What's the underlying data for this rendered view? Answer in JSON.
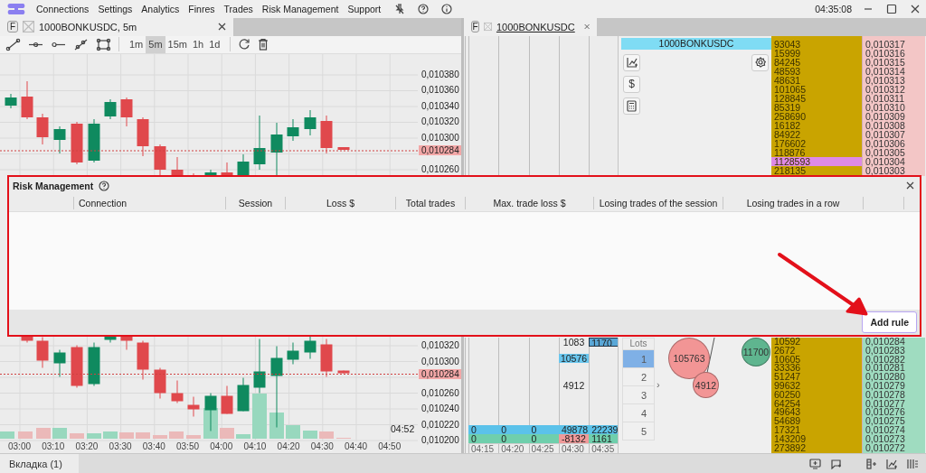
{
  "menu_bar": {
    "items": [
      {
        "label": "Connections"
      },
      {
        "label": "Settings"
      },
      {
        "label": "Analytics"
      },
      {
        "label": "Finres"
      },
      {
        "label": "Trades"
      },
      {
        "label": "Risk Management"
      },
      {
        "label": "Support"
      }
    ],
    "clock": "04:35:08"
  },
  "chart_panel": {
    "tab": {
      "badge": "F",
      "label": "1000BONKUSDC, 5m"
    },
    "timeframes": [
      {
        "label": "1m",
        "selected": false
      },
      {
        "label": "5m",
        "selected": true
      },
      {
        "label": "15m",
        "selected": false
      },
      {
        "label": "1h",
        "selected": false
      },
      {
        "label": "1d",
        "selected": false
      }
    ],
    "upper_axis": {
      "labels": [
        "0,010380",
        "0,010360",
        "0,010340",
        "0,010320",
        "0,010300",
        "0,010260"
      ],
      "last_price": "0,010284"
    },
    "lower_axis": {
      "labels": [
        "0,010320",
        "0,010300",
        "0,010260",
        "0,010240",
        "0,010220",
        "0,010200"
      ],
      "last_price": "0,010284"
    },
    "countdown": "04:52",
    "time_labels": [
      "03:00",
      "03:10",
      "03:20",
      "03:30",
      "03:40",
      "03:50",
      "04:00",
      "04:10",
      "04:20",
      "04:30",
      "04:40",
      "04:50"
    ]
  },
  "order_book": {
    "tab": {
      "badge": "F",
      "label": "1000BONKUSDC"
    },
    "instrument": "1000BONKUSDC",
    "side_buttons": [
      {
        "kind": "chart"
      },
      {
        "kind": "currency",
        "label": "$"
      },
      {
        "kind": "calculator"
      }
    ],
    "asks": [
      {
        "volume": "93043",
        "price": "0,010317",
        "highlighted": false
      },
      {
        "volume": "15999",
        "price": "0,010316",
        "highlighted": false
      },
      {
        "volume": "84245",
        "price": "0,010315",
        "highlighted": false
      },
      {
        "volume": "48593",
        "price": "0,010314",
        "highlighted": false
      },
      {
        "volume": "48631",
        "price": "0,010313",
        "highlighted": false
      },
      {
        "volume": "101065",
        "price": "0,010312",
        "highlighted": false
      },
      {
        "volume": "128845",
        "price": "0,010311",
        "highlighted": false
      },
      {
        "volume": "85319",
        "price": "0,010310",
        "highlighted": false
      },
      {
        "volume": "258690",
        "price": "0,010309",
        "highlighted": false
      },
      {
        "volume": "16182",
        "price": "0,010308",
        "highlighted": false
      },
      {
        "volume": "84922",
        "price": "0,010307",
        "highlighted": false
      },
      {
        "volume": "176602",
        "price": "0,010306",
        "highlighted": false
      },
      {
        "volume": "118876",
        "price": "0,010305",
        "highlighted": false
      },
      {
        "volume": "1128593",
        "price": "0,010304",
        "highlighted": true
      },
      {
        "volume": "218135",
        "price": "0,010303",
        "highlighted": false
      }
    ],
    "bids": [
      {
        "volume": "10592",
        "price": "0,010284"
      },
      {
        "volume": "2672",
        "price": "0,010283"
      },
      {
        "volume": "10605",
        "price": "0,010282"
      },
      {
        "volume": "33336",
        "price": "0,010281"
      },
      {
        "volume": "51247",
        "price": "0,010280"
      },
      {
        "volume": "99632",
        "price": "0,010279"
      },
      {
        "volume": "60250",
        "price": "0,010278"
      },
      {
        "volume": "64254",
        "price": "0,010277"
      },
      {
        "volume": "49643",
        "price": "0,010276"
      },
      {
        "volume": "54689",
        "price": "0,010275"
      },
      {
        "volume": "17321",
        "price": "0,010274"
      },
      {
        "volume": "143209",
        "price": "0,010273"
      },
      {
        "volume": "273892",
        "price": "0,010272"
      }
    ],
    "cluster_cells": [
      {
        "text": "1083",
        "kind": "plain"
      },
      {
        "text": "1170",
        "kind": "outlined"
      },
      {
        "text": "10576",
        "kind": "marked"
      },
      {
        "text": "4912",
        "kind": "plain"
      }
    ],
    "totals_rows": [
      {
        "kind": "buy",
        "cells": [
          {
            "text": "0",
            "negative": false
          },
          {
            "text": "0",
            "negative": false
          },
          {
            "text": "0",
            "negative": false
          },
          {
            "text": "49878",
            "negative": false
          },
          {
            "text": "22239",
            "negative": false
          }
        ]
      },
      {
        "kind": "sell",
        "cells": [
          {
            "text": "0",
            "negative": false
          },
          {
            "text": "0",
            "negative": false
          },
          {
            "text": "0",
            "negative": false
          },
          {
            "text": "-8132",
            "negative": true
          },
          {
            "text": "1161",
            "negative": false
          }
        ]
      }
    ],
    "time_labels": [
      "04:15",
      "04:20",
      "04:25",
      "04:30",
      "04:35"
    ],
    "lots": {
      "title": "Lots",
      "options": [
        {
          "label": "1",
          "selected": true
        },
        {
          "label": "2",
          "selected": false
        },
        {
          "label": "3",
          "selected": false
        },
        {
          "label": "4",
          "selected": false
        },
        {
          "label": "5",
          "selected": false
        }
      ],
      "expander": "›"
    },
    "bubbles": [
      {
        "label": "105763",
        "color": "#f29595"
      },
      {
        "label": "4912",
        "color": "#f29595"
      },
      {
        "label": "11700",
        "color": "#5fb58f"
      }
    ]
  },
  "risk_dialog": {
    "title": "Risk Management",
    "columns": [
      "Connection",
      "Session",
      "Loss $",
      "Total trades",
      "Max. trade loss $",
      "Losing trades of the session",
      "Losing trades in a row"
    ],
    "add_button": "Add rule"
  },
  "status_bar": {
    "tab": "Вкладка (1)"
  }
}
